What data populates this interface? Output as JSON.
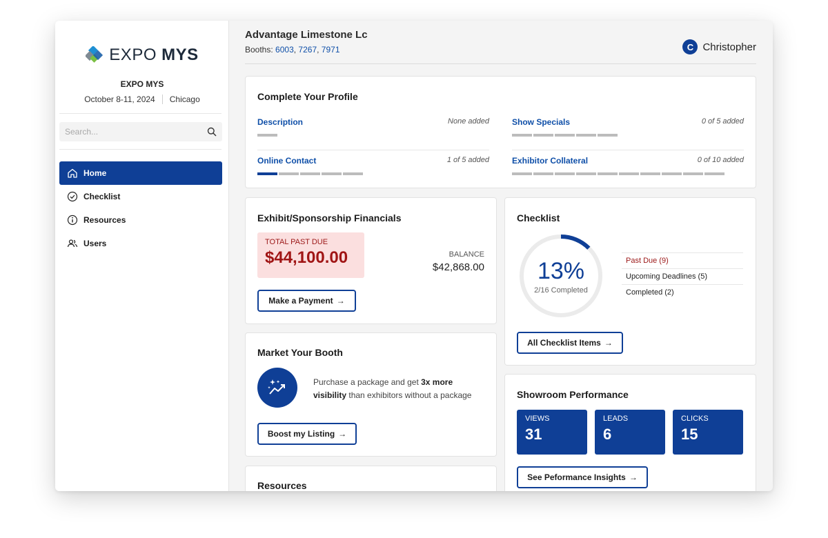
{
  "brand": {
    "logo_light": "EXPO",
    "logo_bold": "MYS",
    "colors": {
      "primary": "#0f3f96",
      "logo_blue": "#1e8fd3",
      "logo_green": "#7ac043",
      "logo_gray": "#7f8a93",
      "danger": "#a01515"
    }
  },
  "event": {
    "name": "EXPO MYS",
    "dates": "October 8-11, 2024",
    "city": "Chicago"
  },
  "search": {
    "placeholder": "Search..."
  },
  "nav": [
    {
      "label": "Home",
      "icon": "home-icon",
      "active": true
    },
    {
      "label": "Checklist",
      "icon": "check-circle-icon",
      "active": false
    },
    {
      "label": "Resources",
      "icon": "info-icon",
      "active": false
    },
    {
      "label": "Users",
      "icon": "users-icon",
      "active": false
    }
  ],
  "header": {
    "company": "Advantage Limestone Lc",
    "booths_label": "Booths:",
    "booths": [
      "6003",
      "7267",
      "7971"
    ],
    "user_initial": "C",
    "user_name": "Christopher"
  },
  "profile": {
    "title": "Complete Your Profile",
    "items": [
      {
        "label": "Description",
        "count": "None added",
        "segments": 1,
        "filled": 0
      },
      {
        "label": "Show Specials",
        "count": "0 of 5 added",
        "segments": 5,
        "filled": 0
      },
      {
        "label": "Online Contact",
        "count": "1 of 5 added",
        "segments": 5,
        "filled": 1
      },
      {
        "label": "Exhibitor Collateral",
        "count": "0 of 10 added",
        "segments": 10,
        "filled": 0
      }
    ]
  },
  "financials": {
    "title": "Exhibit/Sponsorship Financials",
    "past_due_label": "TOTAL PAST DUE",
    "past_due_amount": "$44,100.00",
    "balance_label": "BALANCE",
    "balance_amount": "$42,868.00",
    "button": "Make a Payment"
  },
  "checklist": {
    "title": "Checklist",
    "percent_text": "13%",
    "percent_value": 0.125,
    "completed_text": "2/16 Completed",
    "rows": [
      {
        "label": "Past Due (9)",
        "type": "due"
      },
      {
        "label": "Upcoming Deadlines (5)",
        "type": "normal"
      },
      {
        "label": "Completed (2)",
        "type": "normal"
      }
    ],
    "button": "All Checklist Items"
  },
  "market": {
    "title": "Market Your Booth",
    "text_before": "Purchase a package and get ",
    "text_bold": "3x more visibility",
    "text_after": " than exhibitors without a package",
    "button": "Boost my Listing"
  },
  "resources": {
    "title": "Resources"
  },
  "performance": {
    "title": "Showroom Performance",
    "stats": [
      {
        "label": "VIEWS",
        "value": "31"
      },
      {
        "label": "LEADS",
        "value": "6"
      },
      {
        "label": "CLICKS",
        "value": "15"
      }
    ],
    "button": "See Peformance Insights"
  },
  "arrow": "→"
}
